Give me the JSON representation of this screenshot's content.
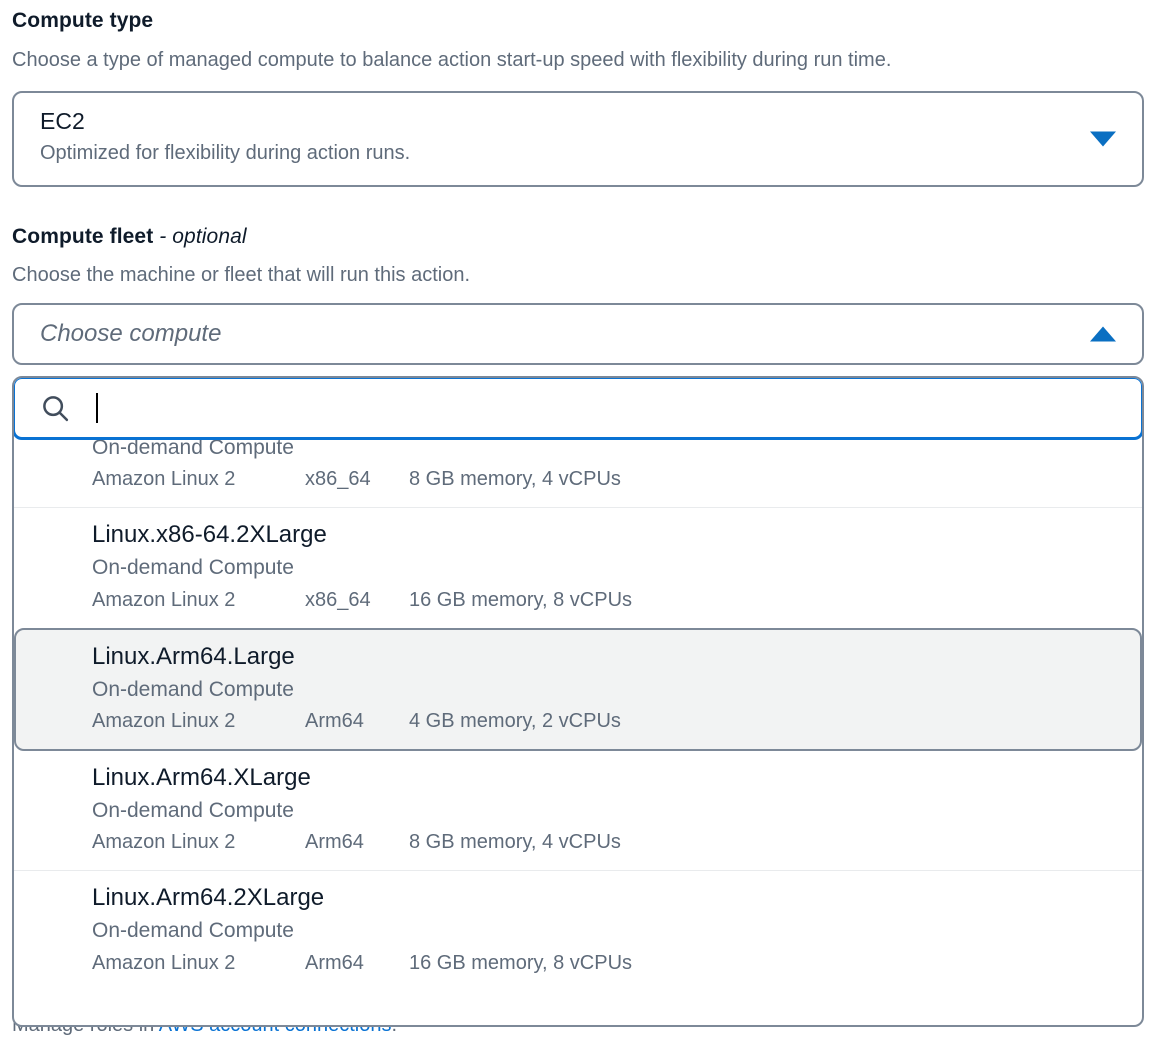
{
  "compute_type": {
    "label": "Compute type",
    "description": "Choose a type of managed compute to balance action start-up speed with flexibility during run time.",
    "selected_title": "EC2",
    "selected_description": "Optimized for flexibility during action runs.",
    "caret_icon": "chevron-down-icon",
    "accent_color": "#0a6fc2"
  },
  "compute_fleet": {
    "label": "Compute fleet",
    "label_optional": "- optional",
    "description": "Choose the machine or fleet that will run this action.",
    "placeholder": "Choose compute",
    "caret_icon": "chevron-up-icon",
    "search": {
      "icon": "search-icon",
      "value": "",
      "placeholder": ""
    },
    "options": [
      {
        "title": "",
        "title_hidden": true,
        "type": "On-demand Compute",
        "os": "Amazon Linux 2",
        "arch": "x86_64",
        "specs": "8 GB memory, 4 vCPUs",
        "selected": false
      },
      {
        "title": "Linux.x86-64.2XLarge",
        "type": "On-demand Compute",
        "os": "Amazon Linux 2",
        "arch": "x86_64",
        "specs": "16 GB memory, 8 vCPUs",
        "selected": false
      },
      {
        "title": "Linux.Arm64.Large",
        "type": "On-demand Compute",
        "os": "Amazon Linux 2",
        "arch": "Arm64",
        "specs": "4 GB memory, 2 vCPUs",
        "selected": true
      },
      {
        "title": "Linux.Arm64.XLarge",
        "type": "On-demand Compute",
        "os": "Amazon Linux 2",
        "arch": "Arm64",
        "specs": "8 GB memory, 4 vCPUs",
        "selected": false
      },
      {
        "title": "Linux.Arm64.2XLarge",
        "type": "On-demand Compute",
        "os": "Amazon Linux 2",
        "arch": "Arm64",
        "specs": "16 GB memory, 8 vCPUs",
        "selected": false
      }
    ]
  },
  "footer_note": {
    "prefix": "Manage roles in ",
    "link_text": "AWS account connections",
    "suffix": ".",
    "link_color": "#0972d3"
  }
}
